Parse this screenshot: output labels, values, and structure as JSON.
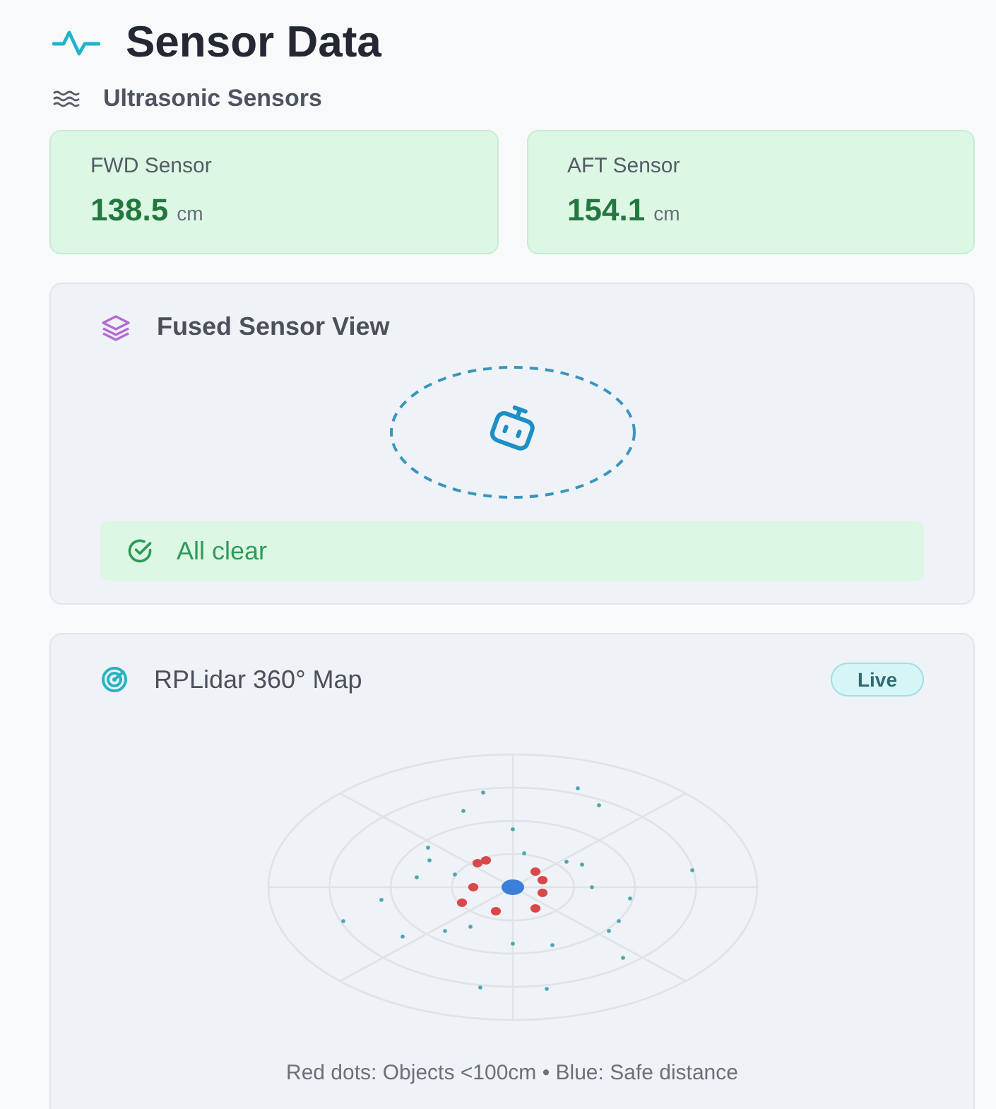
{
  "header": {
    "title": "Sensor Data"
  },
  "ultrasonic": {
    "title": "Ultrasonic Sensors",
    "sensors": [
      {
        "label": "FWD Sensor",
        "value": "138.5",
        "unit": "cm"
      },
      {
        "label": "AFT Sensor",
        "value": "154.1",
        "unit": "cm"
      }
    ]
  },
  "fused": {
    "title": "Fused Sensor View",
    "status": "All clear"
  },
  "lidar": {
    "title": "RPLidar 360° Map",
    "badge": "Live",
    "legend": "Red dots: Objects <100cm • Blue: Safe distance"
  }
}
